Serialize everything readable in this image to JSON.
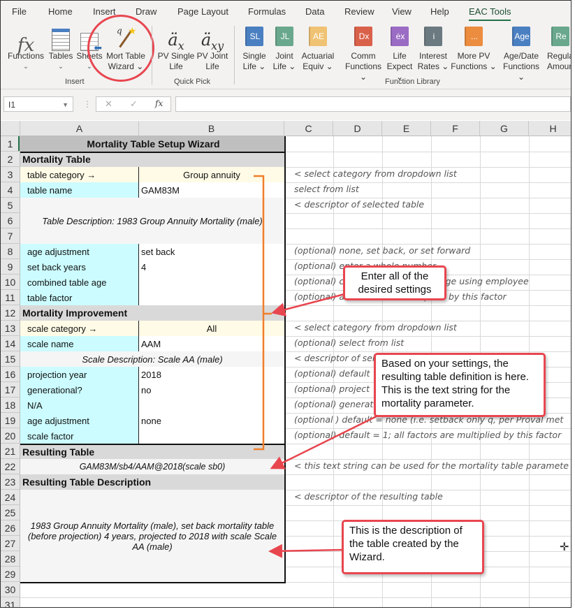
{
  "ribbon_tabs": [
    "File",
    "Home",
    "Insert",
    "Draw",
    "Page Layout",
    "Formulas",
    "Data",
    "Review",
    "View",
    "Help",
    "EAC Tools"
  ],
  "active_tab": "EAC Tools",
  "ribbon": {
    "insert_group": {
      "label": "Insert",
      "buttons": [
        {
          "line1": "Functions",
          "line2": "⌄",
          "icon": "function-fx-icon"
        },
        {
          "line1": "Tables",
          "line2": "⌄",
          "icon": "table-grid-icon"
        },
        {
          "line1": "Sheets",
          "line2": "⌄",
          "icon": "sheets-arrow-icon"
        },
        {
          "line1": "Mort Table",
          "line2": "Wizard ⌄",
          "icon": "magic-wand-icon"
        }
      ]
    },
    "quick_pick_group": {
      "label": "Quick Pick",
      "buttons": [
        {
          "line1": "PV Single",
          "line2": "Life",
          "icon_text": "äx"
        },
        {
          "line1": "PV Joint",
          "line2": "Life",
          "icon_text": "äxy"
        }
      ]
    },
    "function_library_group": {
      "label": "Function Library",
      "buttons": [
        {
          "line1": "Single",
          "line2": "Life ⌄",
          "badge": "SL",
          "color": "#4a7fc1"
        },
        {
          "line1": "Joint",
          "line2": "Life ⌄",
          "badge": "JL",
          "color": "#6aa88e"
        },
        {
          "line1": "Actuarial",
          "line2": "Equiv ⌄",
          "badge": "AE",
          "color": "#f0c274"
        },
        {
          "line1": "Comm",
          "line2": "Functions ⌄",
          "badge": "Dx",
          "color": "#d9614a"
        },
        {
          "line1": "Life",
          "line2": "Expect ⌄",
          "badge": "ėx",
          "color": "#9b6cc4"
        },
        {
          "line1": "Interest",
          "line2": "Rates ⌄",
          "badge": "i",
          "color": "#6b7a80"
        },
        {
          "line1": "More PV",
          "line2": "Functions ⌄",
          "badge": "...",
          "color": "#ec8c3f"
        },
        {
          "line1": "Age/Date",
          "line2": "Functions ⌄",
          "badge": "Age",
          "color": "#4a7fc1"
        },
        {
          "line1": "Regula",
          "line2": "Amoun",
          "badge": "Re",
          "color": "#6aa88e"
        }
      ]
    }
  },
  "formula_bar": {
    "name_box": "I1",
    "cancel": "✕",
    "enter": "✓",
    "fx": "fx",
    "formula": ""
  },
  "columns": [
    "A",
    "B",
    "C",
    "D",
    "E",
    "F",
    "G",
    "H"
  ],
  "rows": [
    "1",
    "2",
    "3",
    "4",
    "5",
    "6",
    "7",
    "8",
    "9",
    "10",
    "11",
    "12",
    "13",
    "14",
    "15",
    "16",
    "17",
    "18",
    "19",
    "20",
    "21",
    "22",
    "23",
    "24",
    "25",
    "26",
    "27",
    "28",
    "29",
    "30",
    "31"
  ],
  "wizard": {
    "title": "Mortality Table Setup Wizard",
    "section_mortality": "Mortality Table",
    "table_category_label": "table category →",
    "table_category_value": "Group annuity",
    "table_name_label": "table name",
    "table_name_value": "GAM83M",
    "table_description": "Table Description: 1983 Group Annuity Mortality (male)",
    "age_adjustment_label": "age adjustment",
    "age_adjustment_value": "set back",
    "set_back_years_label": "set back years",
    "set_back_years_value": "4",
    "combined_table_age_label": "combined table age",
    "combined_table_age_value": "",
    "table_factor_label": "table factor",
    "table_factor_value": "",
    "section_improvement": "Mortality Improvement",
    "scale_category_label": "scale category →",
    "scale_category_value": "All",
    "scale_name_label": "scale name",
    "scale_name_value": "AAM",
    "scale_description": "Scale Description: Scale AA (male)",
    "projection_year_label": "projection year",
    "projection_year_value": "2018",
    "generational_label": "generational?",
    "generational_value": "no",
    "na_label": "N/A",
    "na_value": "",
    "scale_age_adjustment_label": "age adjustment",
    "scale_age_adjustment_value": "none",
    "scale_factor_label": "scale factor",
    "scale_factor_value": "",
    "section_resulting": "Resulting Table",
    "resulting_table": "GAM83M/sb4/AAM@2018(scale sb0)",
    "section_resulting_desc": "Resulting Table Description",
    "resulting_description": "1983 Group Annuity Mortality (male), set back mortality table (before projection) 4 years, projected to 2018 with scale Scale AA (male)"
  },
  "notes": {
    "r3": "< select category from dropdown list",
    "r4": "select from list",
    "r5": "< descriptor of selected table",
    "r8": "(optional) none, set back, or set forward",
    "r9": "(optional) enter a whole number",
    "r10": "(optional) combined table at this age using employee",
    "r11": "(optional) all factors are multiplied by this factor",
    "r13": "< select category from dropdown list",
    "r14": "(optional) select from list",
    "r15": "< descriptor of selected scale",
    "r16": "(optional) default",
    "r17": "(optional) project",
    "r18": "(optional) generat",
    "r19": "(optional ) default = none (i.e. setback only q, per Proval met",
    "r20": "(optional) default = 1; all factors are multiplied by this factor",
    "r22": "< this text string can be used for the mortality table paramete",
    "r24": "< descriptor of the resulting table"
  },
  "callouts": {
    "settings": "Enter all of the desired settings",
    "definition": "Based on your settings, the resulting table definition is here. This is the text string for the mortality parameter.",
    "description": "This is the description of the table created by the Wizard."
  },
  "colors": {
    "accent_green": "#217346",
    "callout_red": "#e8464f",
    "bracket_orange": "#f07f2a",
    "label_cyan": "#ccfcff",
    "input_yellow": "#fffbe6"
  }
}
